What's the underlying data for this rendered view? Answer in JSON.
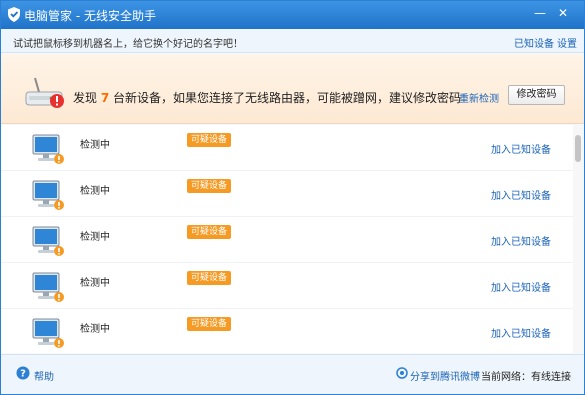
{
  "window": {
    "title": "电脑管家 - 无线安全助手",
    "minimize_glyph": "—",
    "close_glyph": "✕"
  },
  "hint": {
    "text": "试试把鼠标移到机器名上，给它换个好记的名字吧！",
    "known_devices": "已知设备",
    "settings": "设置"
  },
  "banner": {
    "prefix": "发现",
    "count": "7",
    "suffix": "台新设备，如果您连接了无线路由器，可能被蹭网，建议修改密码",
    "recheck": "重新检测",
    "change_password": "修改密码",
    "icon": "router-icon"
  },
  "devices": [
    {
      "status": "检测中",
      "badge": "可疑设备",
      "action": "加入已知设备"
    },
    {
      "status": "检测中",
      "badge": "可疑设备",
      "action": "加入已知设备"
    },
    {
      "status": "检测中",
      "badge": "可疑设备",
      "action": "加入已知设备"
    },
    {
      "status": "检测中",
      "badge": "可疑设备",
      "action": "加入已知设备"
    },
    {
      "status": "检测中",
      "badge": "可疑设备",
      "action": "加入已知设备"
    }
  ],
  "footer": {
    "help": "帮助",
    "share": "分享到腾讯微博",
    "network": "当前网络：有线连接"
  },
  "colors": {
    "titlebar": "#1f73c9",
    "link": "#1a63b8",
    "badge": "#f59a23",
    "highlight": "#ff6b00"
  }
}
